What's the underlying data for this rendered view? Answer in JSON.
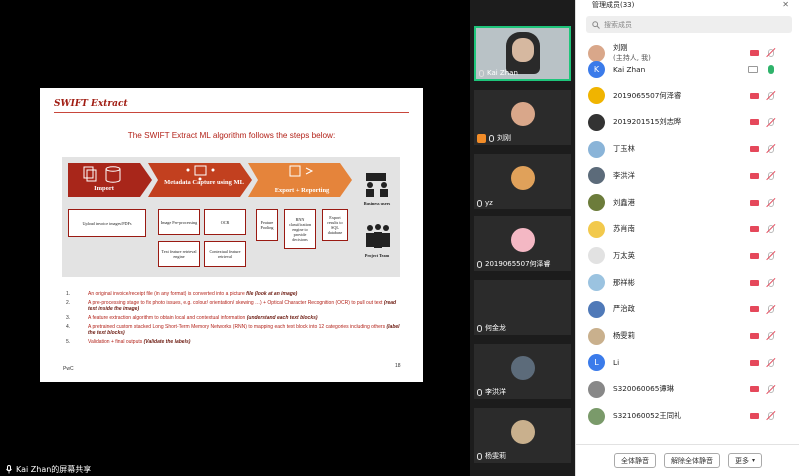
{
  "share": {
    "label": "Kai Zhan的屏幕共享"
  },
  "slide": {
    "title": "SWIFT Extract",
    "subtitle": "The SWIFT Extract ML algorithm follows the steps below:",
    "diagram": {
      "stage_import": "Import",
      "stage_capture": "Metadata Capture using ML",
      "stage_export": "Export + Reporting",
      "import_box": "Upload invoice images/PDFs",
      "capture_boxes": [
        "Image Pre-processing",
        "OCR",
        "Text feature retrieval engine",
        "Contextual feature retrieval"
      ],
      "export_boxes": [
        "Feature Pooling",
        "RNN classification engine to provide decisions",
        "Export results to SQL database"
      ],
      "side_top": "Business users",
      "side_bottom": "Project Team",
      "colors": {
        "import": "#a8261a",
        "capture": "#c2401f",
        "export": "#e5843b"
      }
    },
    "steps": [
      {
        "num": "1.",
        "text": "An original invoice/receipt file (in any format) is converted into a picture ",
        "em": "file (look at an image)"
      },
      {
        "num": "2.",
        "text": "A pre-processing stage to fix photo issues, e.g. colour/ orientation/ skewing …) + Optical Character Recognition (OCR) to pull out text ",
        "em": "(read text inside the image)"
      },
      {
        "num": "3.",
        "text": "A feature extraction algorithm to obtain local and contextual information ",
        "em": "(understand each text blocks)"
      },
      {
        "num": "4.",
        "text": "A pretrained custom stacked Long Short-Term Memory Networks (RNN) to mapping each text block into 12 categories including others ",
        "em": "(label the text blocks)"
      },
      {
        "num": "5.",
        "text": "Validation + final outputs ",
        "em": "(Validate the labels)"
      }
    ],
    "footer": "PwC",
    "page": "18"
  },
  "video_tiles": [
    {
      "name": "Kai Zhan",
      "active": true,
      "kind": "camera"
    },
    {
      "name": "刘刚",
      "host": true,
      "avatar_color": "#d9a78a"
    },
    {
      "name": "yz",
      "avatar_color": "#e0a15a"
    },
    {
      "name": "2019065507何泽睿",
      "avatar_color": "#f4b8c4"
    },
    {
      "name": "何金龙"
    },
    {
      "name": "李洪洋",
      "avatar_color": "#5c6b7a"
    },
    {
      "name": "杨雯莉",
      "avatar_color": "#c9b08d"
    }
  ],
  "panel": {
    "header": "管理成员(33)",
    "close": "✕",
    "search_placeholder": "搜索成员",
    "members": [
      {
        "name": "刘刚",
        "role": "(主持人, 我)",
        "avatar_color": "#d9a78a"
      },
      {
        "name": "Kai Zhan",
        "avatar_letter": "K",
        "avatar_color": "#3b7bea",
        "sharing": true
      },
      {
        "name": "2019065507何泽睿",
        "avatar_color": "#f0b400"
      },
      {
        "name": "2019201515刘志晔",
        "avatar_color": "#333333"
      },
      {
        "name": "丁玉林",
        "avatar_color": "#8ab4d8"
      },
      {
        "name": "李洪洋",
        "avatar_color": "#5c6b7a"
      },
      {
        "name": "刘鑫港",
        "avatar_color": "#6c7c3b"
      },
      {
        "name": "苏肖南",
        "avatar_color": "#f2c94c"
      },
      {
        "name": "万太英",
        "avatar_color": "#e2e2e2"
      },
      {
        "name": "那祥彬",
        "avatar_color": "#9bc3e0"
      },
      {
        "name": "严治政",
        "avatar_color": "#4f79b8"
      },
      {
        "name": "杨雯莉",
        "avatar_color": "#c9b08d"
      },
      {
        "name": "Li",
        "avatar_letter": "L",
        "avatar_color": "#3b7bea"
      },
      {
        "name": "S320060065谭琳",
        "avatar_color": "#888888"
      },
      {
        "name": "S321060052王同礼",
        "avatar_color": "#7a9a6a"
      }
    ],
    "footer_buttons": [
      "全体静音",
      "解除全体静音",
      "更多"
    ]
  }
}
